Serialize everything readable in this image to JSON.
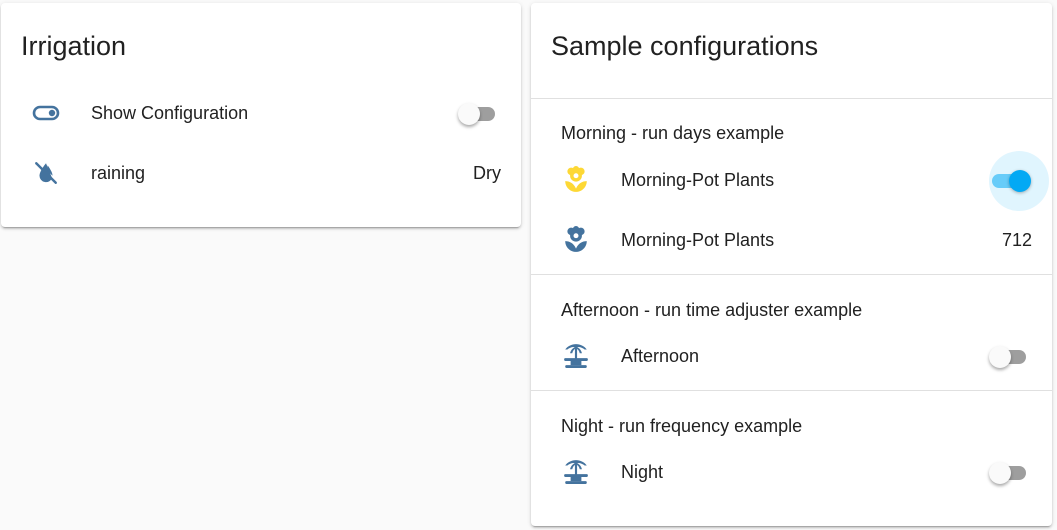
{
  "irrigation_card": {
    "title": "Irrigation",
    "rows": [
      {
        "icon": "toggle-switch-icon",
        "label": "Show Configuration",
        "state": "off"
      },
      {
        "icon": "water-off-icon",
        "label": "raining",
        "value": "Dry"
      }
    ]
  },
  "sample_card": {
    "title": "Sample configurations",
    "sections": [
      {
        "title": "Morning - run days example",
        "rows": [
          {
            "icon": "flower-icon",
            "label": "Morning-Pot Plants",
            "state": "on"
          },
          {
            "icon": "flower-icon",
            "label": "Morning-Pot Plants",
            "value": "712"
          }
        ]
      },
      {
        "title": "Afternoon - run time adjuster example",
        "rows": [
          {
            "icon": "fountain-icon",
            "label": "Afternoon",
            "state": "off"
          }
        ]
      },
      {
        "title": "Night - run frequency example",
        "rows": [
          {
            "icon": "fountain-icon",
            "label": "Night",
            "state": "off"
          }
        ]
      }
    ]
  },
  "colors": {
    "icon_default": "#44739e",
    "icon_active": "#fdd835",
    "toggle_on": "#03a9f4",
    "divider": "#e0e0e0"
  }
}
